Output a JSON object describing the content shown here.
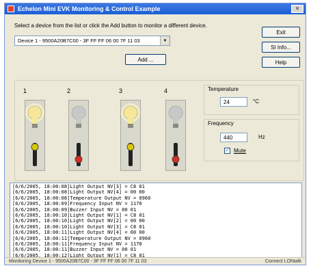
{
  "window": {
    "title": "Echelon Mini EVK Monitoring & Control Example",
    "close_glyph": "✕"
  },
  "instruction": "Select a device from the list or click the Add button to monitor a different device.",
  "device_select": {
    "value": "Device 1 - 9500A20B7C00 - 3F FF FF 06 00 7F 11 03"
  },
  "buttons": {
    "add": "Add ...",
    "exit": "Exit",
    "si_info": "SI Info...",
    "help": "Help"
  },
  "lamps": [
    {
      "label": "1",
      "light": "on",
      "switch": "on"
    },
    {
      "label": "2",
      "light": "off",
      "switch": "off"
    },
    {
      "label": "3",
      "light": "on",
      "switch": "on"
    },
    {
      "label": "4",
      "light": "off",
      "switch": "off"
    }
  ],
  "temperature": {
    "label": "Temperature",
    "value": "24",
    "unit": "°C"
  },
  "frequency": {
    "label": "Frequency",
    "value": "440",
    "unit": "Hz",
    "mute_label": "Mute",
    "mute_checked": true
  },
  "log": [
    "[6/6/2005, 18:00:08]Light Output NV[3] = C8 01",
    "[6/6/2005, 18:00:08]Light Output NV[4] = 00 00",
    "[6/6/2005, 18:00:08]Temperature Output NV = 0960",
    "[6/6/2005, 18:00:09]Frequency Input NV = 1170",
    "[6/6/2005, 18:00:09]Buzzer Input NV = 00 01",
    "[6/6/2005, 18:00:10]Light Output NV[1] = C8 01",
    "[6/6/2005, 18:00:10]Light Output NV[2] = 00 00",
    "[6/6/2005, 18:00:10]Light Output NV[3] = C8 01",
    "[6/6/2005, 18:00:11]Light Output NV[4] = 00 00",
    "[6/6/2005, 18:00:11]Temperature Output NV = 0960",
    "[6/6/2005, 18:00:11]Frequency Input NV = 1170",
    "[6/6/2005, 18:00:11]Buzzer Input NV = 00 01",
    "[6/6/2005, 18:00:12]Light Output NV[1] = C8 01"
  ],
  "status": {
    "left": "Monitoring Device 1 - 9500A20B7C00 - 3F FF FF 06 00 7F 11 03",
    "right": "Connect LONtalk"
  },
  "colors": {
    "bulb_on": "#f4e79a",
    "bulb_off": "#c8c8c8",
    "switch_on": "#d8c800",
    "switch_off": "#d83020",
    "title_bar": "#1b5fd6"
  },
  "icons": {
    "app": "app-icon",
    "dropdown": "chevron-down-icon",
    "bulb": "light-bulb-icon",
    "switch": "toggle-switch-icon"
  }
}
